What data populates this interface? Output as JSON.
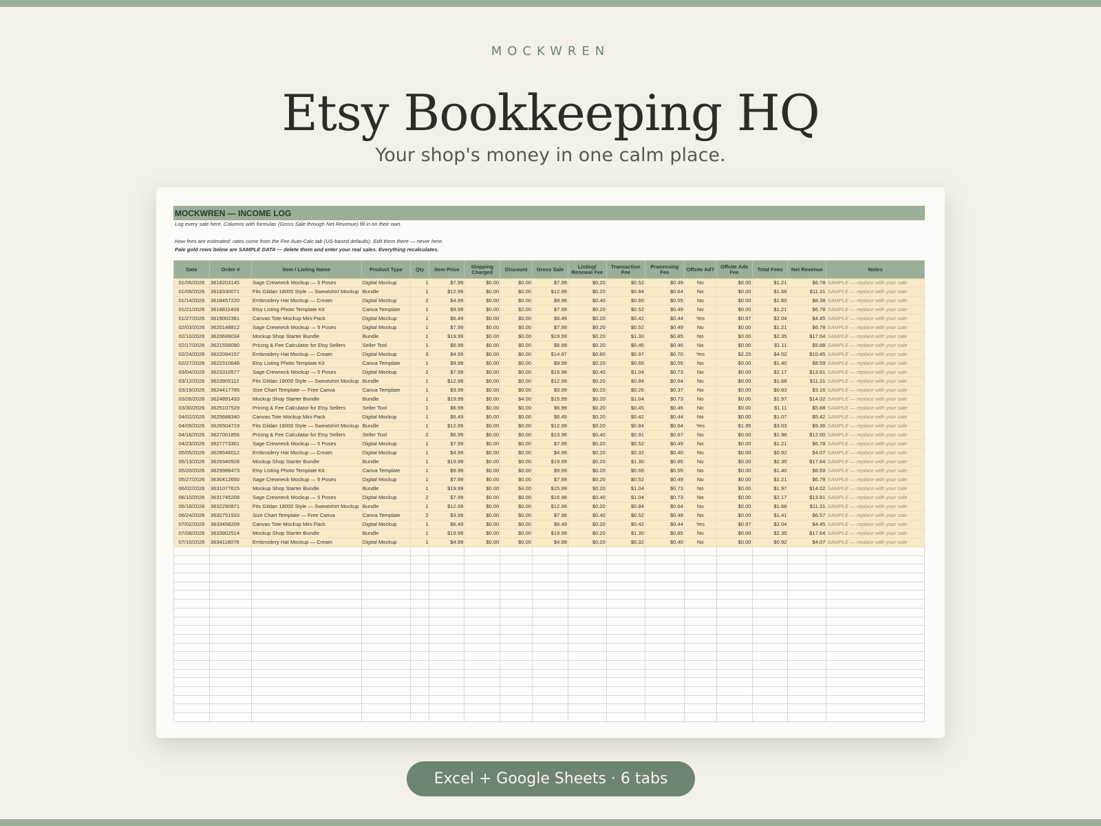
{
  "brand": "MOCKWREN",
  "title": "Etsy Bookkeeping HQ",
  "subtitle": "Your shop's money in one calm place.",
  "badge": "Excel + Google Sheets · 6 tabs",
  "sheet": {
    "title": "MOCKWREN — INCOME LOG",
    "note1": "Log every sale here. Columns with formulas (Gross Sale through Net Revenue) fill in on their own.",
    "note2": "How fees are estimated:  rates come from the Fee Auto-Calc tab (US-based defaults). Edit them there — never here.",
    "note3": "Pale gold rows below are SAMPLE DATA — delete them and enter your real sales. Everything recalculates.",
    "headers": [
      "Date",
      "Order #",
      "Item / Listing Name",
      "Product Type",
      "Qty",
      "Item Price",
      "Shipping Charged",
      "Discount",
      "Gross Sale",
      "Listing/ Renewal Fee",
      "Transaction Fee",
      "Processing Fee",
      "Offsite Ad?",
      "Offsite Ads Fee",
      "Total Fees",
      "Net Revenue",
      "Notes"
    ],
    "rows": [
      [
        "01/06/2026",
        "3618203145",
        "Sage Crewneck Mockup — 5 Poses",
        "Digital Mockup",
        "1",
        "$7.99",
        "$0.00",
        "$0.00",
        "$7.99",
        "$0.20",
        "$0.52",
        "$0.49",
        "No",
        "$0.00",
        "$1.21",
        "$6.78",
        "SAMPLE — replace with your sale"
      ],
      [
        "01/09/2026",
        "3618330071",
        "Fits Gildan 18000 Style — Sweatshirt Mockup",
        "Bundle",
        "1",
        "$12.99",
        "$0.00",
        "$0.00",
        "$12.99",
        "$0.20",
        "$0.84",
        "$0.64",
        "No",
        "$0.00",
        "$1.68",
        "$11.31",
        "SAMPLE — replace with your sale"
      ],
      [
        "01/14/2026",
        "3618457220",
        "Embroidery Hat Mockup — Cream",
        "Digital Mockup",
        "2",
        "$4.99",
        "$0.00",
        "$0.00",
        "$9.98",
        "$0.40",
        "$0.65",
        "$0.55",
        "No",
        "$0.00",
        "$1.60",
        "$8.38",
        "SAMPLE — replace with your sale"
      ],
      [
        "01/21/2026",
        "3618811409",
        "Etsy Listing Photo Template Kit",
        "Canva Template",
        "1",
        "$9.99",
        "$0.00",
        "$2.00",
        "$7.99",
        "$0.20",
        "$0.52",
        "$0.49",
        "No",
        "$0.00",
        "$1.21",
        "$6.78",
        "SAMPLE — replace with your sale"
      ],
      [
        "01/27/2026",
        "3619002381",
        "Canvas Tote Mockup Mini Pack",
        "Digital Mockup",
        "1",
        "$6.49",
        "$0.00",
        "$0.00",
        "$6.49",
        "$0.20",
        "$0.42",
        "$0.44",
        "Yes",
        "$0.97",
        "$2.04",
        "$4.45",
        "SAMPLE — replace with your sale"
      ],
      [
        "02/03/2026",
        "3620148812",
        "Sage Crewneck Mockup — 5 Poses",
        "Digital Mockup",
        "1",
        "$7.99",
        "$0.00",
        "$0.00",
        "$7.99",
        "$0.20",
        "$0.52",
        "$0.49",
        "No",
        "$0.00",
        "$1.21",
        "$6.78",
        "SAMPLE — replace with your sale"
      ],
      [
        "02/10/2026",
        "3620699034",
        "Mockup Shop Starter Bundle",
        "Bundle",
        "1",
        "$19.99",
        "$0.00",
        "$0.00",
        "$19.99",
        "$0.20",
        "$1.30",
        "$0.85",
        "No",
        "$0.00",
        "$2.35",
        "$17.64",
        "SAMPLE — replace with your sale"
      ],
      [
        "02/17/2026",
        "3621558090",
        "Pricing & Fee Calculator for Etsy Sellers",
        "Seller Tool",
        "1",
        "$6.99",
        "$0.00",
        "$0.00",
        "$6.99",
        "$0.20",
        "$0.45",
        "$0.46",
        "No",
        "$0.00",
        "$1.11",
        "$5.88",
        "SAMPLE — replace with your sale"
      ],
      [
        "02/24/2026",
        "3622094157",
        "Embroidery Hat Mockup — Cream",
        "Digital Mockup",
        "3",
        "$4.99",
        "$0.00",
        "$0.00",
        "$14.97",
        "$0.60",
        "$0.97",
        "$0.70",
        "Yes",
        "$2.25",
        "$4.52",
        "$10.45",
        "SAMPLE — replace with your sale"
      ],
      [
        "02/27/2026",
        "3622310648",
        "Etsy Listing Photo Template Kit",
        "Canva Template",
        "1",
        "$9.99",
        "$0.00",
        "$0.00",
        "$9.99",
        "$0.20",
        "$0.65",
        "$0.55",
        "No",
        "$0.00",
        "$1.40",
        "$8.59",
        "SAMPLE — replace with your sale"
      ],
      [
        "03/04/2026",
        "3623310577",
        "Sage Crewneck Mockup — 5 Poses",
        "Digital Mockup",
        "2",
        "$7.99",
        "$0.00",
        "$0.00",
        "$15.98",
        "$0.40",
        "$1.04",
        "$0.73",
        "No",
        "$0.00",
        "$2.17",
        "$13.81",
        "SAMPLE — replace with your sale"
      ],
      [
        "03/12/2026",
        "3623905112",
        "Fits Gildan 18000 Style — Sweatshirt Mockup",
        "Bundle",
        "1",
        "$12.99",
        "$0.00",
        "$0.00",
        "$12.99",
        "$0.20",
        "$0.84",
        "$0.64",
        "No",
        "$0.00",
        "$1.68",
        "$11.31",
        "SAMPLE — replace with your sale"
      ],
      [
        "03/19/2026",
        "3624417785",
        "Size Chart Template — Free Canva",
        "Canva Template",
        "1",
        "$3.99",
        "$0.00",
        "$0.00",
        "$3.99",
        "$0.20",
        "$0.26",
        "$0.37",
        "No",
        "$0.00",
        "$0.83",
        "$3.16",
        "SAMPLE — replace with your sale"
      ],
      [
        "03/26/2026",
        "3624891433",
        "Mockup Shop Starter Bundle",
        "Bundle",
        "1",
        "$19.99",
        "$0.00",
        "$4.00",
        "$15.99",
        "$0.20",
        "$1.04",
        "$0.73",
        "No",
        "$0.00",
        "$1.97",
        "$14.02",
        "SAMPLE — replace with your sale"
      ],
      [
        "03/30/2026",
        "3625107529",
        "Pricing & Fee Calculator for Etsy Sellers",
        "Seller Tool",
        "1",
        "$6.99",
        "$0.00",
        "$0.00",
        "$6.99",
        "$0.20",
        "$0.45",
        "$0.46",
        "No",
        "$0.00",
        "$1.11",
        "$5.88",
        "SAMPLE — replace with your sale"
      ],
      [
        "04/02/2026",
        "3625688340",
        "Canvas Tote Mockup Mini Pack",
        "Digital Mockup",
        "1",
        "$6.49",
        "$0.00",
        "$0.00",
        "$6.49",
        "$0.20",
        "$0.42",
        "$0.44",
        "No",
        "$0.00",
        "$1.07",
        "$5.42",
        "SAMPLE — replace with your sale"
      ],
      [
        "04/09/2026",
        "3626504719",
        "Fits Gildan 18000 Style — Sweatshirt Mockup",
        "Bundle",
        "1",
        "$12.99",
        "$0.00",
        "$0.00",
        "$12.99",
        "$0.20",
        "$0.84",
        "$0.64",
        "Yes",
        "$1.95",
        "$3.63",
        "$9.36",
        "SAMPLE — replace with your sale"
      ],
      [
        "04/16/2026",
        "3627001856",
        "Pricing & Fee Calculator for Etsy Sellers",
        "Seller Tool",
        "2",
        "$6.99",
        "$0.00",
        "$0.00",
        "$13.98",
        "$0.40",
        "$0.91",
        "$0.67",
        "No",
        "$0.00",
        "$1.98",
        "$12.00",
        "SAMPLE — replace with your sale"
      ],
      [
        "04/23/2026",
        "3627773301",
        "Sage Crewneck Mockup — 5 Poses",
        "Digital Mockup",
        "1",
        "$7.99",
        "$0.00",
        "$0.00",
        "$7.99",
        "$0.20",
        "$0.52",
        "$0.49",
        "No",
        "$0.00",
        "$1.21",
        "$6.78",
        "SAMPLE — replace with your sale"
      ],
      [
        "05/05/2026",
        "3628546012",
        "Embroidery Hat Mockup — Cream",
        "Digital Mockup",
        "1",
        "$4.99",
        "$0.00",
        "$0.00",
        "$4.99",
        "$0.20",
        "$0.32",
        "$0.40",
        "No",
        "$0.00",
        "$0.92",
        "$4.07",
        "SAMPLE — replace with your sale"
      ],
      [
        "05/13/2026",
        "3629340928",
        "Mockup Shop Starter Bundle",
        "Bundle",
        "1",
        "$19.99",
        "$0.00",
        "$0.00",
        "$19.99",
        "$0.20",
        "$1.30",
        "$0.85",
        "No",
        "$0.00",
        "$2.35",
        "$17.64",
        "SAMPLE — replace with your sale"
      ],
      [
        "05/20/2026",
        "3629988473",
        "Etsy Listing Photo Template Kit",
        "Canva Template",
        "1",
        "$9.99",
        "$0.00",
        "$0.00",
        "$9.99",
        "$0.20",
        "$0.65",
        "$0.55",
        "No",
        "$0.00",
        "$1.40",
        "$8.59",
        "SAMPLE — replace with your sale"
      ],
      [
        "05/27/2026",
        "3630412650",
        "Sage Crewneck Mockup — 5 Poses",
        "Digital Mockup",
        "1",
        "$7.99",
        "$0.00",
        "$0.00",
        "$7.99",
        "$0.20",
        "$0.52",
        "$0.49",
        "No",
        "$0.00",
        "$1.21",
        "$6.78",
        "SAMPLE — replace with your sale"
      ],
      [
        "06/02/2026",
        "3631077615",
        "Mockup Shop Starter Bundle",
        "Bundle",
        "1",
        "$19.99",
        "$0.00",
        "$4.00",
        "$15.99",
        "$0.20",
        "$1.04",
        "$0.73",
        "No",
        "$0.00",
        "$1.97",
        "$14.02",
        "SAMPLE — replace with your sale"
      ],
      [
        "06/10/2026",
        "3631745208",
        "Sage Crewneck Mockup — 5 Poses",
        "Digital Mockup",
        "2",
        "$7.99",
        "$0.00",
        "$0.00",
        "$15.98",
        "$0.40",
        "$1.04",
        "$0.73",
        "No",
        "$0.00",
        "$2.17",
        "$13.81",
        "SAMPLE — replace with your sale"
      ],
      [
        "06/18/2026",
        "3632290871",
        "Fits Gildan 18000 Style — Sweatshirt Mockup",
        "Bundle",
        "1",
        "$12.99",
        "$0.00",
        "$0.00",
        "$12.99",
        "$0.20",
        "$0.84",
        "$0.64",
        "No",
        "$0.00",
        "$1.68",
        "$11.31",
        "SAMPLE — replace with your sale"
      ],
      [
        "06/24/2026",
        "3632751933",
        "Size Chart Template — Free Canva",
        "Canva Template",
        "2",
        "$3.99",
        "$0.00",
        "$0.00",
        "$7.98",
        "$0.40",
        "$0.52",
        "$0.49",
        "No",
        "$0.00",
        "$1.41",
        "$6.57",
        "SAMPLE — replace with your sale"
      ],
      [
        "07/02/2026",
        "3633458209",
        "Canvas Tote Mockup Mini Pack",
        "Digital Mockup",
        "1",
        "$6.49",
        "$0.00",
        "$0.00",
        "$6.49",
        "$0.20",
        "$0.42",
        "$0.44",
        "Yes",
        "$0.97",
        "$2.04",
        "$4.45",
        "SAMPLE — replace with your sale"
      ],
      [
        "07/08/2026",
        "3633902514",
        "Mockup Shop Starter Bundle",
        "Bundle",
        "1",
        "$19.99",
        "$0.00",
        "$0.00",
        "$19.99",
        "$0.20",
        "$1.30",
        "$0.85",
        "No",
        "$0.00",
        "$2.35",
        "$17.64",
        "SAMPLE — replace with your sale"
      ],
      [
        "07/10/2026",
        "3634118076",
        "Embroidery Hat Mockup — Cream",
        "Digital Mockup",
        "1",
        "$4.99",
        "$0.00",
        "$0.00",
        "$4.99",
        "$0.20",
        "$0.32",
        "$0.40",
        "No",
        "$0.00",
        "$0.92",
        "$4.07",
        "SAMPLE — replace with your sale"
      ]
    ],
    "empty_rows": 20
  },
  "colors": {
    "accent": "#9bae98",
    "badge_bg": "#6d8470",
    "sample_row": "#faeac7",
    "background": "#f3f1e9"
  }
}
